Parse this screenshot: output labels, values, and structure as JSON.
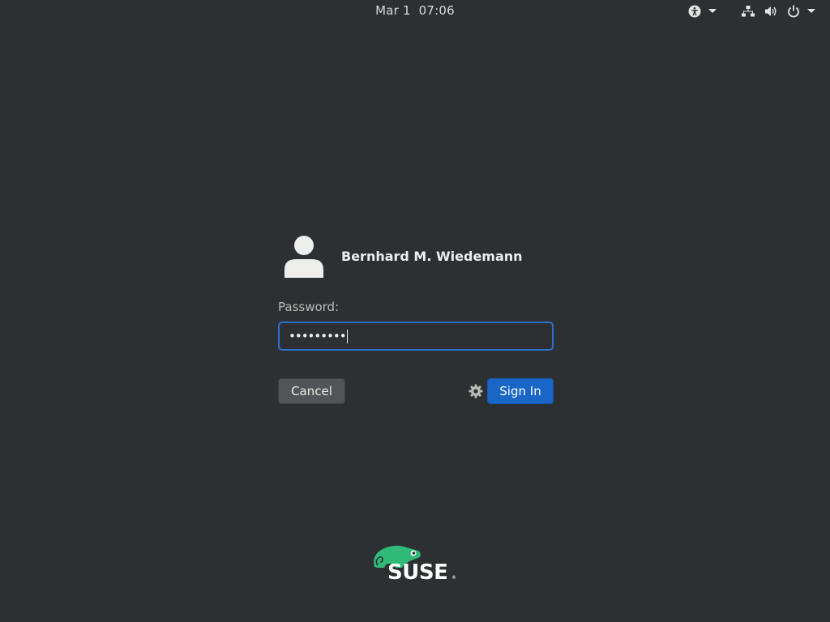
{
  "topbar": {
    "clock_date": "Mar 1",
    "clock_time": "07:06",
    "icons": [
      "accessibility-icon",
      "chevron-down-icon",
      "network-wired-icon",
      "volume-icon",
      "power-icon",
      "chevron-down-icon"
    ]
  },
  "login": {
    "user_name": "Bernhard M. Wiedemann",
    "password_label": "Password:",
    "password_mask": "•••••••••",
    "cancel_label": "Cancel",
    "signin_label": "Sign In",
    "session_icon": "gear-icon"
  },
  "branding": {
    "logo_text": "SUSE",
    "logo_reg": "®",
    "logo_color": "#30ba78"
  },
  "colors": {
    "background": "#2c3033",
    "focus": "#2d6fc9",
    "signin": "#1a66c7",
    "cancel": "#4f5558"
  }
}
